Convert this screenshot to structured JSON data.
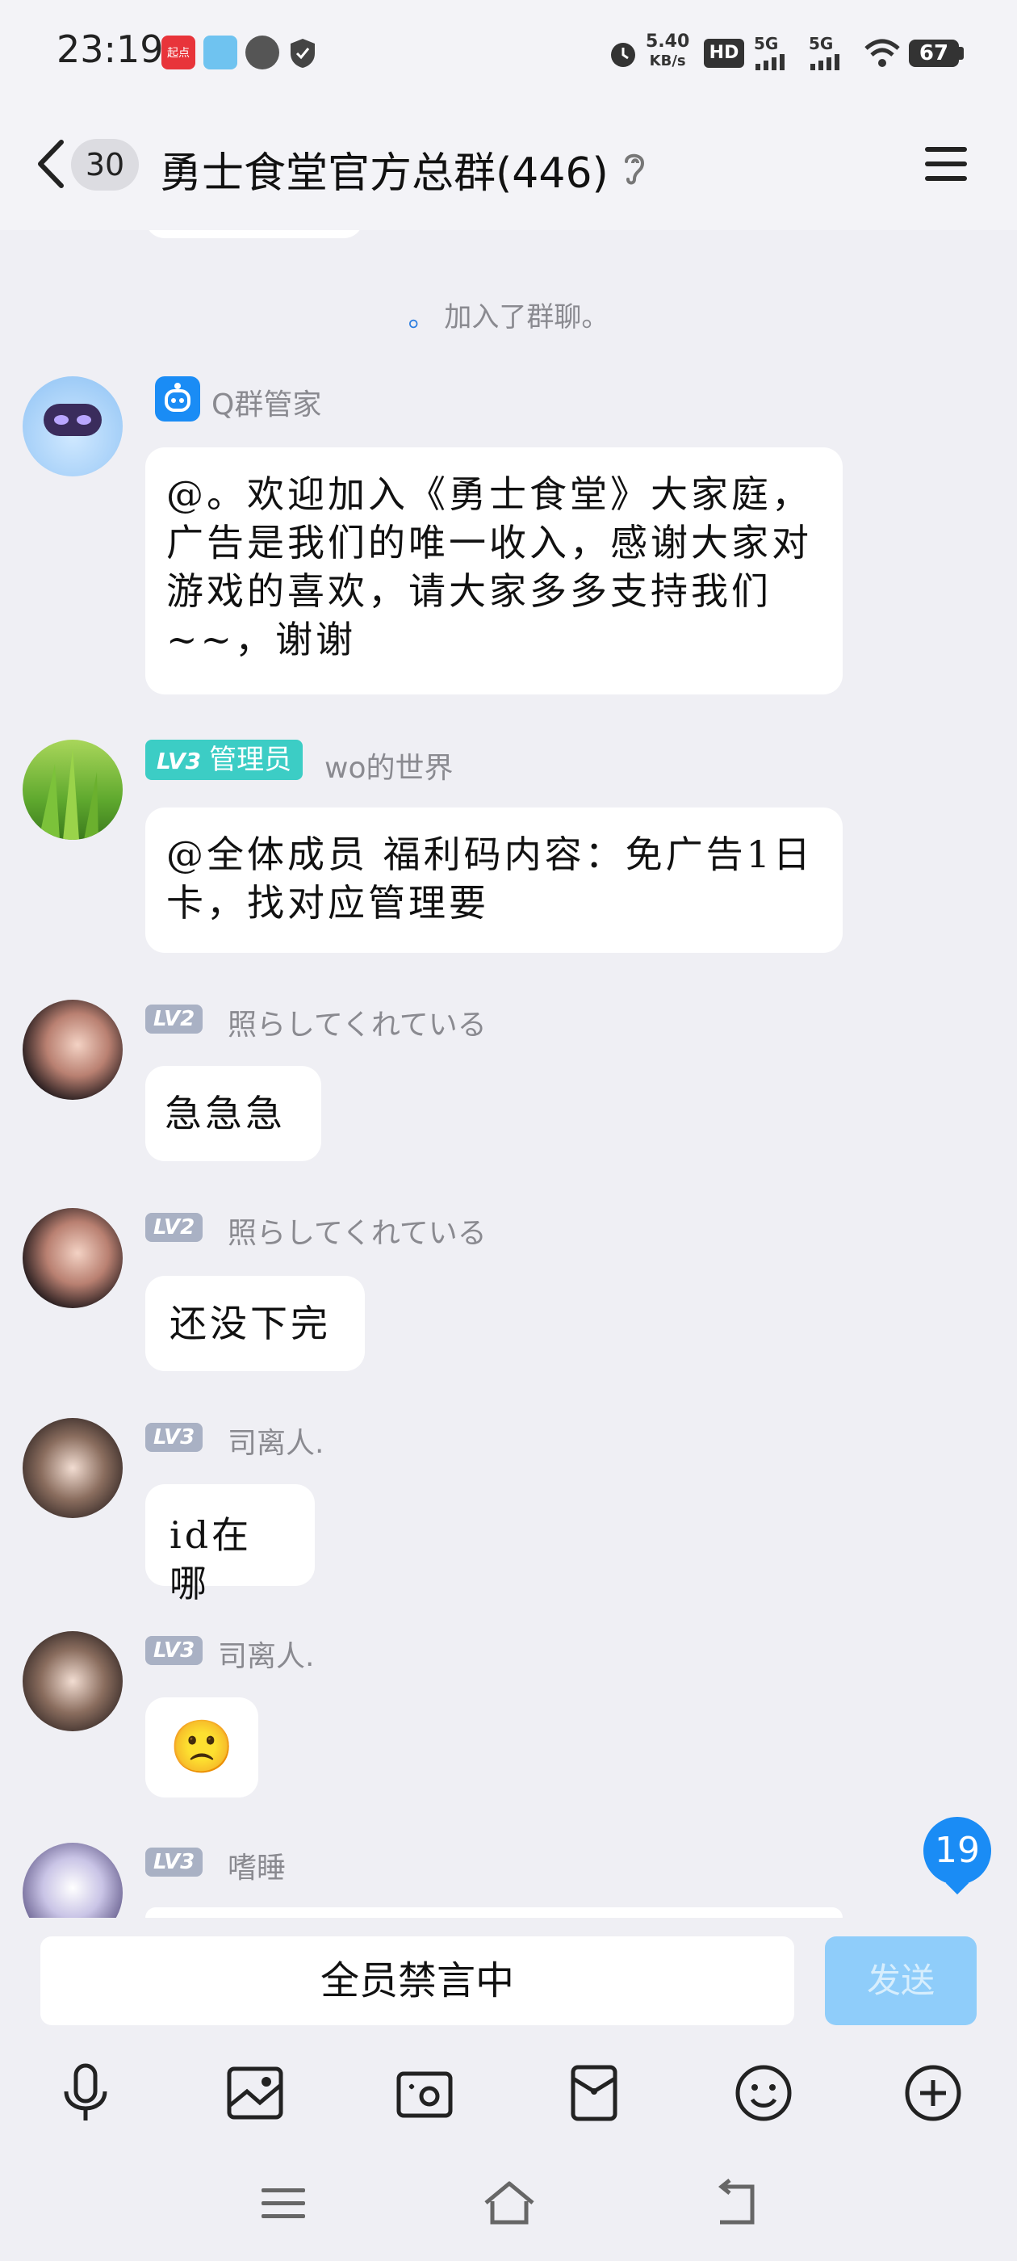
{
  "status_bar": {
    "time": "23:19",
    "apps": [
      "起点",
      "",
      "",
      ""
    ],
    "net_speed_value": "5.40",
    "net_speed_unit": "KB/s",
    "hd_label": "HD",
    "sim1": "5G",
    "sim2": "5G",
    "battery": "67",
    "icons": [
      "alarm-icon",
      "hd-icon",
      "signal-icon",
      "wifi-icon",
      "battery-icon"
    ]
  },
  "header": {
    "unread_count": "30",
    "title": "勇士食堂官方总群(446)",
    "icons": [
      "back-arrow-icon",
      "ear-icon",
      "menu-icon"
    ]
  },
  "system_message": {
    "name": "。",
    "text": "加入了群聊。"
  },
  "messages": [
    {
      "sender": "Q群管家",
      "level": "",
      "role": "",
      "text": "@。欢迎加入《勇士食堂》大家庭，广告是我们的唯一收入，感谢大家对游戏的喜欢，请大家多多支持我们~~，谢谢"
    },
    {
      "sender": "wo的世界",
      "level": "LV3",
      "role": "管理员",
      "text": "@全体成员 福利码内容：免广告1日卡，找对应管理要"
    },
    {
      "sender": "照らしてくれている",
      "level": "LV2",
      "role": "",
      "text": "急急急"
    },
    {
      "sender": "照らしてくれている",
      "level": "LV2",
      "role": "",
      "text": "还没下完"
    },
    {
      "sender": "司离人.",
      "level": "LV3",
      "role": "",
      "text": "id在哪"
    },
    {
      "sender": "司离人.",
      "level": "LV3",
      "role": "",
      "text": "🙁"
    },
    {
      "sender": "嗜睡",
      "level": "LV3",
      "role": "",
      "text": ""
    }
  ],
  "unread_new": "19",
  "input": {
    "placeholder": "全员禁言中",
    "send_label": "发送"
  },
  "toolbar_icons": [
    "microphone-icon",
    "image-icon",
    "camera-icon",
    "red-packet-icon",
    "emoji-icon",
    "plus-icon"
  ],
  "colors": {
    "accent": "#1a8cf5",
    "admin_badge": "#3ccdc5",
    "level_badge": "#a9b1c4",
    "background": "#efeff4"
  }
}
